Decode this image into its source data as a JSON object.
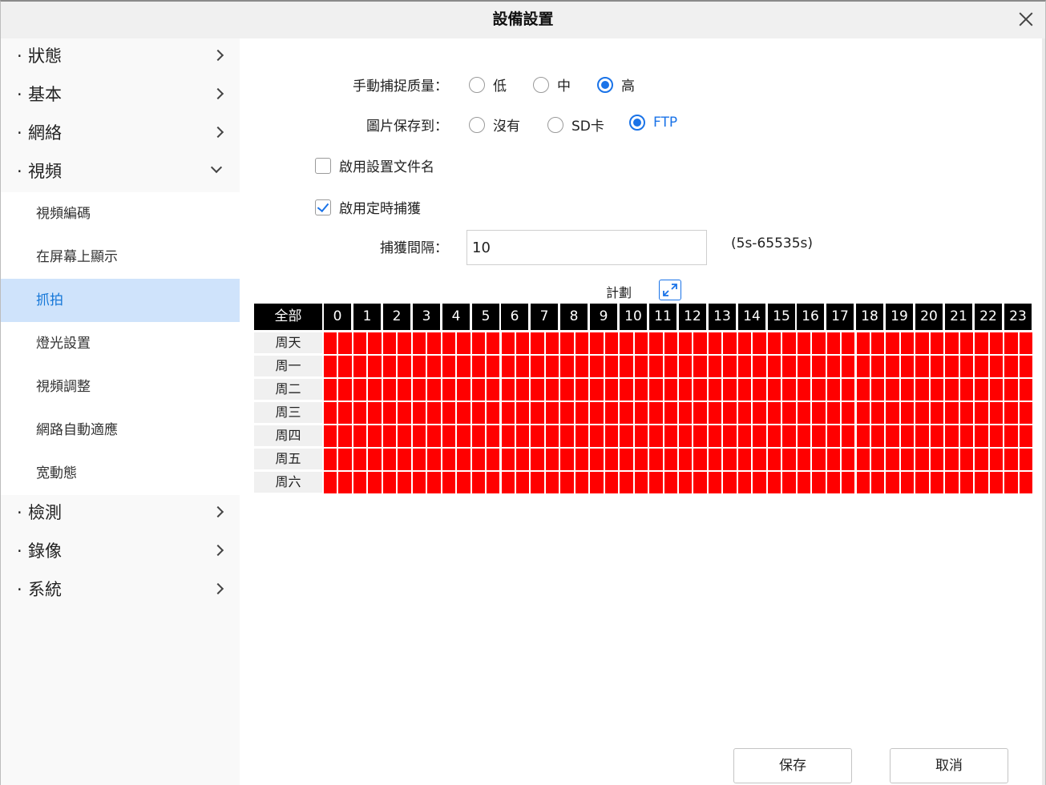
{
  "dialog": {
    "title": "設備設置"
  },
  "sidebar": {
    "top_items": [
      {
        "label": "狀態"
      },
      {
        "label": "基本"
      },
      {
        "label": "網絡"
      },
      {
        "label": "視頻"
      }
    ],
    "video_sub_items": [
      {
        "label": "視頻編碼"
      },
      {
        "label": "在屏幕上顯示"
      },
      {
        "label": "抓拍",
        "active": true
      },
      {
        "label": "燈光設置"
      },
      {
        "label": "視頻調整"
      },
      {
        "label": "網路自動適應"
      },
      {
        "label": "宽動態"
      }
    ],
    "bottom_items": [
      {
        "label": "檢測"
      },
      {
        "label": "錄像"
      },
      {
        "label": "系統"
      }
    ],
    "bullet": "·"
  },
  "form": {
    "quality": {
      "label": "手動捕捉质量：",
      "options": [
        "低",
        "中",
        "高"
      ],
      "selected": "高"
    },
    "save_to": {
      "label": "圖片保存到：",
      "options": [
        "沒有",
        "SD卡",
        "FTP"
      ],
      "selected": "FTP"
    },
    "enable_filename": {
      "label": "啟用設置文件名",
      "checked": false
    },
    "enable_timed": {
      "label": "啟用定時捕獲",
      "checked": true
    },
    "interval": {
      "label": "捕獲間隔：",
      "value": "10",
      "hint": "(5s-65535s)"
    }
  },
  "schedule": {
    "title": "計劃",
    "all_label": "全部",
    "hours": [
      "0",
      "1",
      "2",
      "3",
      "4",
      "5",
      "6",
      "7",
      "8",
      "9",
      "10",
      "11",
      "12",
      "13",
      "14",
      "15",
      "16",
      "17",
      "18",
      "19",
      "20",
      "21",
      "22",
      "23"
    ],
    "days": [
      "周天",
      "周一",
      "周二",
      "周三",
      "周四",
      "周五",
      "周六"
    ],
    "all_selected": true,
    "selected_color": "#ff0000"
  },
  "buttons": {
    "save": "保存",
    "cancel": "取消"
  },
  "colors": {
    "accent": "#1a73e8",
    "active_bg": "#cfe3fb"
  }
}
